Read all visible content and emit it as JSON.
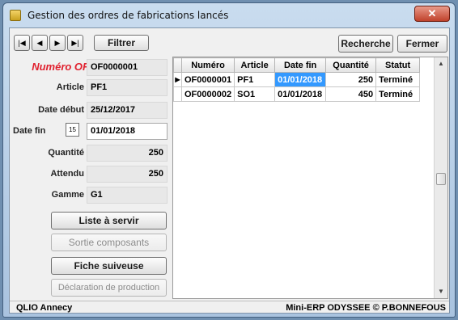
{
  "window": {
    "title": "Gestion des ordres de fabrications lancés",
    "close_glyph": "✕",
    "icon": "app-icon"
  },
  "toolbar": {
    "first_glyph": "|◀",
    "prev_glyph": "◀",
    "next_glyph": "▶",
    "last_glyph": "▶|",
    "filter_label": "Filtrer",
    "search_label": "Recherche",
    "close_label": "Fermer"
  },
  "form": {
    "of_label": "Numéro OF",
    "of_value": "OF0000001",
    "article_label": "Article",
    "article_value": "PF1",
    "date_debut_label": "Date début",
    "date_debut_value": "25/12/2017",
    "date_fin_label": "Date fin",
    "date_fin_value": "01/01/2018",
    "calendar_glyph": "15",
    "quantite_label": "Quantité",
    "quantite_value": "250",
    "attendu_label": "Attendu",
    "attendu_value": "250",
    "gamme_label": "Gamme",
    "gamme_value": "G1"
  },
  "actions": {
    "liste_label": "Liste à servir",
    "sortie_label": "Sortie composants",
    "fiche_label": "Fiche suiveuse",
    "declaration_label": "Déclaration de production"
  },
  "table": {
    "columns": [
      "Numéro",
      "Article",
      "Date fin",
      "Quantité",
      "Statut"
    ],
    "rows": [
      {
        "numero": "OF0000001",
        "article": "PF1",
        "date_fin": "01/01/2018",
        "quantite": "250",
        "statut": "Terminé",
        "current": true
      },
      {
        "numero": "OF0000002",
        "article": "SO1",
        "date_fin": "01/01/2018",
        "quantite": "450",
        "statut": "Terminé",
        "current": false
      }
    ],
    "row_indicator": "▶",
    "scroll_up": "▲",
    "scroll_down": "▼"
  },
  "status": {
    "left": "QLIO Annecy",
    "right": "Mini-ERP ODYSSEE © P.BONNEFOUS"
  },
  "colors": {
    "of_label": "#e0202e",
    "selection": "#3399ff",
    "close_button": "#c0422b"
  }
}
